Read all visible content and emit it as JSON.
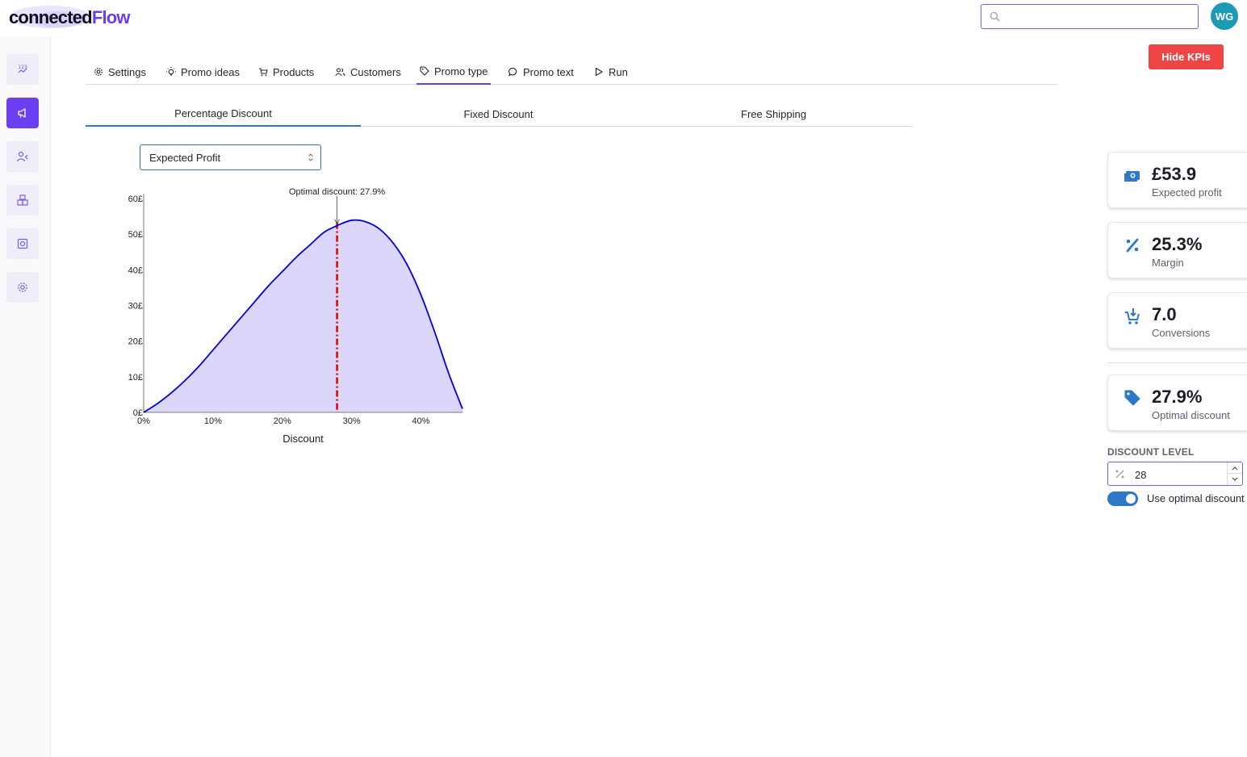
{
  "app": {
    "logo_part1": "connected",
    "logo_part2": "Flow",
    "search_placeholder": "",
    "avatar_initials": "WG"
  },
  "sidebar": {
    "items": [
      {
        "name": "numbers-icon",
        "label": "123"
      },
      {
        "name": "megaphone-icon",
        "active": true
      },
      {
        "name": "customer-icon"
      },
      {
        "name": "boxes-icon"
      },
      {
        "name": "product-icon"
      },
      {
        "name": "gear-icon"
      }
    ]
  },
  "tabs": [
    {
      "label": "Settings",
      "icon": "gear-icon"
    },
    {
      "label": "Promo ideas",
      "icon": "lightbulb-icon"
    },
    {
      "label": "Products",
      "icon": "cart-icon"
    },
    {
      "label": "Customers",
      "icon": "users-icon"
    },
    {
      "label": "Promo type",
      "icon": "tag-icon",
      "active": true
    },
    {
      "label": "Promo text",
      "icon": "chat-bubble-icon"
    },
    {
      "label": "Run",
      "icon": "play-icon"
    }
  ],
  "hide_kpis_label": "Hide KPIs",
  "subtabs": [
    {
      "label": "Percentage Discount",
      "active": true
    },
    {
      "label": "Fixed Discount"
    },
    {
      "label": "Free Shipping"
    }
  ],
  "metric_select": {
    "value": "Expected Profit"
  },
  "chart_data": {
    "type": "area",
    "xlabel": "Discount",
    "ylabel": "",
    "x_ticks": [
      "0%",
      "10%",
      "20%",
      "30%",
      "40%"
    ],
    "y_ticks": [
      "0£",
      "10£",
      "20£",
      "30£",
      "40£",
      "50£",
      "60£"
    ],
    "xlim": [
      0,
      46
    ],
    "ylim": [
      0,
      60
    ],
    "x": [
      0,
      2,
      4,
      6,
      8,
      10,
      12,
      14,
      16,
      18,
      20,
      22,
      24,
      26,
      27.9,
      28,
      30,
      32,
      34,
      36,
      38,
      40,
      42,
      44,
      46
    ],
    "y": [
      0,
      2.5,
      5.5,
      9,
      13,
      17.5,
      22,
      26.5,
      31,
      35.5,
      39.5,
      43.5,
      47,
      50.5,
      52.4,
      52.5,
      53.9,
      53.5,
      51.5,
      47.5,
      41.5,
      33,
      22.5,
      11,
      1
    ],
    "annotation": {
      "text": "Optimal discount: 27.9%",
      "x": 27.9
    },
    "colors": {
      "line": "#0000dd",
      "fill": "#ddd6fb",
      "optimal_line": "#dd0000"
    },
    "grid": false
  },
  "kpis": [
    {
      "value": "£53.9",
      "label": "Expected profit",
      "icon": "money-icon"
    },
    {
      "value": "25.3%",
      "label": "Margin",
      "icon": "percent-icon"
    },
    {
      "value": "7.0",
      "label": "Conversions",
      "icon": "cart-plus-icon"
    },
    {
      "value": "27.9%",
      "label": "Optimal discount",
      "icon": "tag-icon"
    }
  ],
  "discount_level": {
    "label": "DISCOUNT LEVEL",
    "value": "28"
  },
  "optimal_toggle": {
    "label": "Use optimal discount",
    "on": true
  },
  "colors": {
    "accent": "#6c3ef2",
    "danger": "#f04545",
    "kpi_icon": "#2d78c8"
  }
}
